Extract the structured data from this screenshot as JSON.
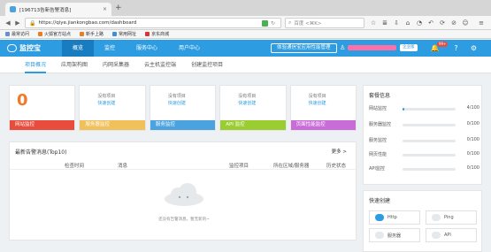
{
  "browser": {
    "tab_title": "[196713告新告警消息]",
    "url": "https://qiye.jiankongbao.com/dashboard",
    "search_placeholder": "百度 <⌘K>",
    "bookmarks": [
      "最常访问",
      "火狐官方站点",
      "新手上路",
      "常用网址",
      "京东商城"
    ]
  },
  "header": {
    "logo": "监控宝",
    "nav": [
      "概览",
      "监控",
      "服务中心",
      "用户中心"
    ],
    "trial_button": "体验通信宝应用性能管理",
    "user_tag": "企业版",
    "badge": "99+"
  },
  "subnav": [
    "项目概况",
    "应用架构图",
    "内网采集器",
    "云主机监控端",
    "创建监控项目"
  ],
  "cards": [
    {
      "big": "0",
      "lines": [],
      "link": "",
      "footer": "网站监控",
      "color": "#e74c3c"
    },
    {
      "big": "",
      "lines": [
        "没有项目"
      ],
      "link": "快速创建",
      "footer": "服务器监控",
      "color": "#f0c05a"
    },
    {
      "big": "",
      "lines": [
        "没有项目"
      ],
      "link": "快速创建",
      "footer": "服务监控",
      "color": "#4aa3df"
    },
    {
      "big": "",
      "lines": [
        "没有项目"
      ],
      "link": "快速创建",
      "footer": "API 监控",
      "color": "#9acd32"
    },
    {
      "big": "",
      "lines": [
        "没有项目"
      ],
      "link": "快速创建",
      "footer": "页面性能监控",
      "color": "#c86dd7"
    }
  ],
  "alerts": {
    "title": "最新告警消息(Top10)",
    "more": "更多 >",
    "columns": [
      "检查时间",
      "消息",
      "监控项目",
      "所在区域/服务器",
      "历史状态"
    ],
    "empty_text": "还没有告警消息，暂无新的~"
  },
  "alarm_info": {
    "title": "套餐信息",
    "rows": [
      {
        "label": "网站监控",
        "count": "4/100",
        "fill": 0.04
      },
      {
        "label": "服务器监控",
        "count": "0/100",
        "fill": 0
      },
      {
        "label": "服务监控",
        "count": "0/100",
        "fill": 0
      },
      {
        "label": "网页性能",
        "count": "0/100",
        "fill": 0
      },
      {
        "label": "API监控",
        "count": "0/100",
        "fill": 0
      }
    ]
  },
  "quick_create": {
    "title": "快速创建",
    "items": [
      "Http",
      "Ping",
      "服务器",
      "API"
    ]
  }
}
